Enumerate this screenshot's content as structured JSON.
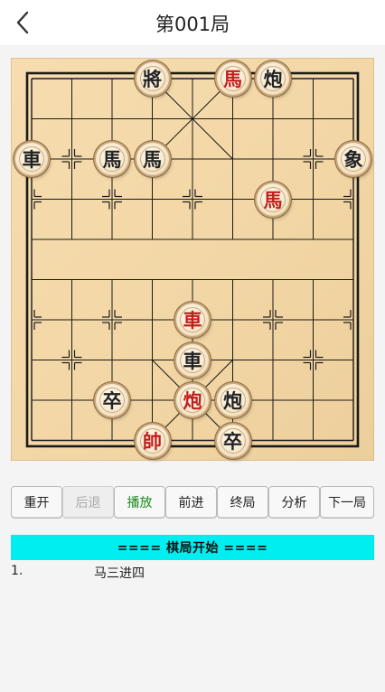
{
  "header": {
    "title": "第001局",
    "back_icon": "chevron-left-icon"
  },
  "board": {
    "pieces": [
      {
        "id": "b-jiang",
        "char": "將",
        "color": "black"
      },
      {
        "id": "r-ma-1",
        "char": "馬",
        "color": "red"
      },
      {
        "id": "b-pao-1",
        "char": "炮",
        "color": "black"
      },
      {
        "id": "b-ju-1",
        "char": "車",
        "color": "black"
      },
      {
        "id": "b-ma-1",
        "char": "馬",
        "color": "black"
      },
      {
        "id": "b-ma-2",
        "char": "馬",
        "color": "black"
      },
      {
        "id": "b-xiang",
        "char": "象",
        "color": "black"
      },
      {
        "id": "r-ma-2",
        "char": "馬",
        "color": "red"
      },
      {
        "id": "r-ju",
        "char": "車",
        "color": "red"
      },
      {
        "id": "b-ju-2",
        "char": "車",
        "color": "black"
      },
      {
        "id": "b-zu-1",
        "char": "卒",
        "color": "black"
      },
      {
        "id": "r-pao",
        "char": "炮",
        "color": "red"
      },
      {
        "id": "b-pao-2",
        "char": "炮",
        "color": "black"
      },
      {
        "id": "r-shuai",
        "char": "帥",
        "color": "red"
      },
      {
        "id": "b-zu-2",
        "char": "卒",
        "color": "black"
      }
    ]
  },
  "controls": {
    "restart": "重开",
    "undo": "后退",
    "play": "播放",
    "forward": "前进",
    "end": "终局",
    "analyze": "分析",
    "next": "下一局"
  },
  "log": {
    "banner": "==== 棋局开始 ====",
    "moves": [
      {
        "num": "1.",
        "text": "马三进四"
      }
    ]
  },
  "colors": {
    "banner_bg": "#00eef0",
    "red_piece": "#c0201a",
    "play_text": "#198a1f"
  }
}
